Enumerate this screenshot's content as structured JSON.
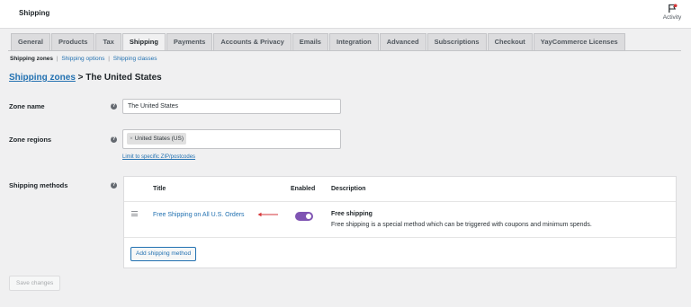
{
  "header": {
    "title": "Shipping",
    "activity_label": "Activity",
    "activity_icon": "flag-icon"
  },
  "tabs": [
    {
      "label": "General",
      "active": false
    },
    {
      "label": "Products",
      "active": false
    },
    {
      "label": "Tax",
      "active": false
    },
    {
      "label": "Shipping",
      "active": true
    },
    {
      "label": "Payments",
      "active": false
    },
    {
      "label": "Accounts & Privacy",
      "active": false
    },
    {
      "label": "Emails",
      "active": false
    },
    {
      "label": "Integration",
      "active": false
    },
    {
      "label": "Advanced",
      "active": false
    },
    {
      "label": "Subscriptions",
      "active": false
    },
    {
      "label": "Checkout",
      "active": false
    },
    {
      "label": "YayCommerce Licenses",
      "active": false
    }
  ],
  "subnav": {
    "current": "Shipping zones",
    "sep": "|",
    "options": "Shipping options",
    "classes": "Shipping classes"
  },
  "breadcrumb": {
    "link": "Shipping zones",
    "rest": " > The United States"
  },
  "zone_name": {
    "label": "Zone name",
    "value": "The United States"
  },
  "zone_regions": {
    "label": "Zone regions",
    "chip_remove": "×",
    "chip": "United States (US)",
    "limit_link": "Limit to specific ZIP/postcodes"
  },
  "shipping_methods": {
    "label": "Shipping methods",
    "columns": {
      "title": "Title",
      "enabled": "Enabled",
      "description": "Description"
    },
    "rows": [
      {
        "title": "Free Shipping on All U.S. Orders",
        "enabled": true,
        "desc_title": "Free shipping",
        "desc_text": "Free shipping is a special method which can be triggered with coupons and minimum spends."
      }
    ],
    "add_button": "Add shipping method"
  },
  "help_icon_glyph": "?",
  "save_button": "Save changes",
  "colors": {
    "link": "#2271b1",
    "toggle": "#7f54b3",
    "arrow": "#d63638"
  }
}
